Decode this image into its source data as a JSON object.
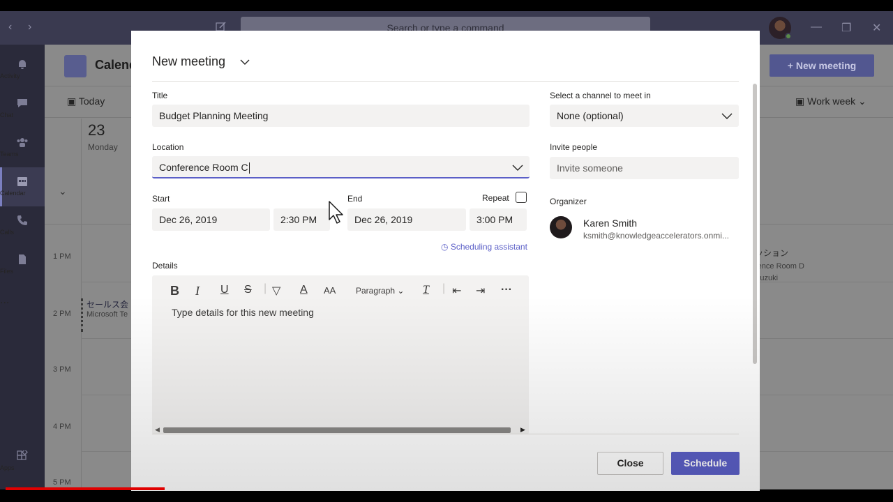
{
  "app": {
    "search_placeholder": "Search or type a command",
    "rail": [
      {
        "label": "Activity",
        "icon": "bell-icon"
      },
      {
        "label": "Chat",
        "icon": "chat-icon"
      },
      {
        "label": "Teams",
        "icon": "teams-icon"
      },
      {
        "label": "Calendar",
        "icon": "calendar-icon"
      },
      {
        "label": "Calls",
        "icon": "phone-icon"
      },
      {
        "label": "Files",
        "icon": "file-icon"
      },
      {
        "label": "...",
        "icon": "more-icon"
      },
      {
        "label": "Apps",
        "icon": "apps-icon"
      }
    ],
    "calendar_title": "Calend",
    "new_meeting_label": "+ New meeting",
    "today_label": "Today",
    "work_week_label": "Work week",
    "day_number": "23",
    "day_name": "Monday",
    "hours": [
      "1 PM",
      "2 PM",
      "3 PM",
      "4 PM",
      "5 PM"
    ],
    "event_left": {
      "title": "セールス会",
      "sub": "Microsoft Te"
    },
    "event_right": {
      "title": "ッション",
      "sub1": "rence Room D",
      "sub2": "Suzuki"
    }
  },
  "dialog": {
    "title": "New meeting",
    "title_field": {
      "label": "Title",
      "value": "Budget Planning Meeting"
    },
    "location_field": {
      "label": "Location",
      "value": "Conference Room C"
    },
    "start": {
      "label": "Start",
      "date": "Dec 26, 2019",
      "time": "2:30 PM"
    },
    "end": {
      "label": "End",
      "date": "Dec 26, 2019",
      "time": "3:00 PM"
    },
    "repeat_label": "Repeat",
    "repeat_checked": false,
    "scheduling_assistant": "Scheduling assistant",
    "details_label": "Details",
    "details_placeholder": "Type details for this new meeting",
    "paragraph_label": "Paragraph",
    "channel": {
      "label": "Select a channel to meet in",
      "value": "None (optional)"
    },
    "invite": {
      "label": "Invite people",
      "placeholder": "Invite someone"
    },
    "organizer": {
      "label": "Organizer",
      "name": "Karen Smith",
      "email": "ksmith@knowledgeaccelerators.onmi..."
    },
    "close_label": "Close",
    "schedule_label": "Schedule"
  },
  "colors": {
    "accent": "#5b5fc7",
    "progress_bar": "#e00000"
  },
  "video_progress_fraction": 0.18
}
